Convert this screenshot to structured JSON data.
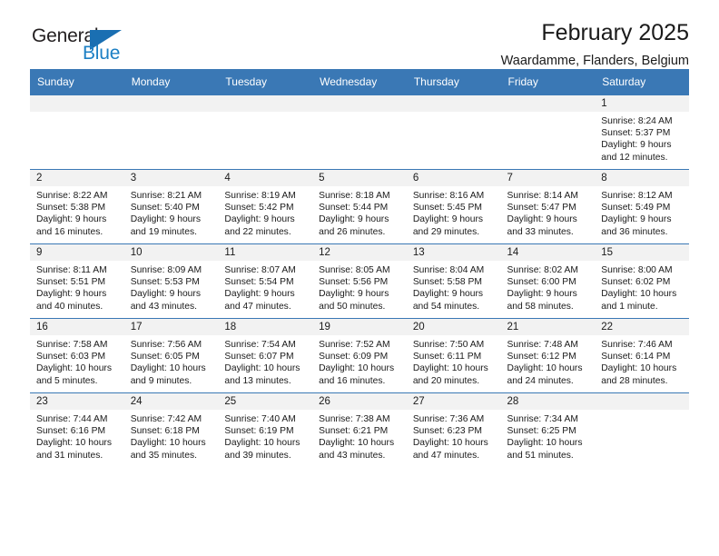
{
  "brand": {
    "name_part1": "General",
    "name_part2": "Blue",
    "accent_color": "#1c7fc4",
    "triangle_icon": "triangle-icon"
  },
  "header": {
    "title": "February 2025",
    "subtitle": "Waardamme, Flanders, Belgium",
    "header_bg_color": "#3a78b5"
  },
  "weekday_headers": [
    "Sunday",
    "Monday",
    "Tuesday",
    "Wednesday",
    "Thursday",
    "Friday",
    "Saturday"
  ],
  "weeks": [
    [
      {
        "day": "",
        "sunrise": "",
        "sunset": "",
        "daylight_line1": "",
        "daylight_line2": "",
        "empty": true
      },
      {
        "day": "",
        "sunrise": "",
        "sunset": "",
        "daylight_line1": "",
        "daylight_line2": "",
        "empty": true
      },
      {
        "day": "",
        "sunrise": "",
        "sunset": "",
        "daylight_line1": "",
        "daylight_line2": "",
        "empty": true
      },
      {
        "day": "",
        "sunrise": "",
        "sunset": "",
        "daylight_line1": "",
        "daylight_line2": "",
        "empty": true
      },
      {
        "day": "",
        "sunrise": "",
        "sunset": "",
        "daylight_line1": "",
        "daylight_line2": "",
        "empty": true
      },
      {
        "day": "",
        "sunrise": "",
        "sunset": "",
        "daylight_line1": "",
        "daylight_line2": "",
        "empty": true
      },
      {
        "day": "1",
        "sunrise": "Sunrise: 8:24 AM",
        "sunset": "Sunset: 5:37 PM",
        "daylight_line1": "Daylight: 9 hours",
        "daylight_line2": "and 12 minutes.",
        "empty": false
      }
    ],
    [
      {
        "day": "2",
        "sunrise": "Sunrise: 8:22 AM",
        "sunset": "Sunset: 5:38 PM",
        "daylight_line1": "Daylight: 9 hours",
        "daylight_line2": "and 16 minutes.",
        "empty": false
      },
      {
        "day": "3",
        "sunrise": "Sunrise: 8:21 AM",
        "sunset": "Sunset: 5:40 PM",
        "daylight_line1": "Daylight: 9 hours",
        "daylight_line2": "and 19 minutes.",
        "empty": false
      },
      {
        "day": "4",
        "sunrise": "Sunrise: 8:19 AM",
        "sunset": "Sunset: 5:42 PM",
        "daylight_line1": "Daylight: 9 hours",
        "daylight_line2": "and 22 minutes.",
        "empty": false
      },
      {
        "day": "5",
        "sunrise": "Sunrise: 8:18 AM",
        "sunset": "Sunset: 5:44 PM",
        "daylight_line1": "Daylight: 9 hours",
        "daylight_line2": "and 26 minutes.",
        "empty": false
      },
      {
        "day": "6",
        "sunrise": "Sunrise: 8:16 AM",
        "sunset": "Sunset: 5:45 PM",
        "daylight_line1": "Daylight: 9 hours",
        "daylight_line2": "and 29 minutes.",
        "empty": false
      },
      {
        "day": "7",
        "sunrise": "Sunrise: 8:14 AM",
        "sunset": "Sunset: 5:47 PM",
        "daylight_line1": "Daylight: 9 hours",
        "daylight_line2": "and 33 minutes.",
        "empty": false
      },
      {
        "day": "8",
        "sunrise": "Sunrise: 8:12 AM",
        "sunset": "Sunset: 5:49 PM",
        "daylight_line1": "Daylight: 9 hours",
        "daylight_line2": "and 36 minutes.",
        "empty": false
      }
    ],
    [
      {
        "day": "9",
        "sunrise": "Sunrise: 8:11 AM",
        "sunset": "Sunset: 5:51 PM",
        "daylight_line1": "Daylight: 9 hours",
        "daylight_line2": "and 40 minutes.",
        "empty": false
      },
      {
        "day": "10",
        "sunrise": "Sunrise: 8:09 AM",
        "sunset": "Sunset: 5:53 PM",
        "daylight_line1": "Daylight: 9 hours",
        "daylight_line2": "and 43 minutes.",
        "empty": false
      },
      {
        "day": "11",
        "sunrise": "Sunrise: 8:07 AM",
        "sunset": "Sunset: 5:54 PM",
        "daylight_line1": "Daylight: 9 hours",
        "daylight_line2": "and 47 minutes.",
        "empty": false
      },
      {
        "day": "12",
        "sunrise": "Sunrise: 8:05 AM",
        "sunset": "Sunset: 5:56 PM",
        "daylight_line1": "Daylight: 9 hours",
        "daylight_line2": "and 50 minutes.",
        "empty": false
      },
      {
        "day": "13",
        "sunrise": "Sunrise: 8:04 AM",
        "sunset": "Sunset: 5:58 PM",
        "daylight_line1": "Daylight: 9 hours",
        "daylight_line2": "and 54 minutes.",
        "empty": false
      },
      {
        "day": "14",
        "sunrise": "Sunrise: 8:02 AM",
        "sunset": "Sunset: 6:00 PM",
        "daylight_line1": "Daylight: 9 hours",
        "daylight_line2": "and 58 minutes.",
        "empty": false
      },
      {
        "day": "15",
        "sunrise": "Sunrise: 8:00 AM",
        "sunset": "Sunset: 6:02 PM",
        "daylight_line1": "Daylight: 10 hours",
        "daylight_line2": "and 1 minute.",
        "empty": false
      }
    ],
    [
      {
        "day": "16",
        "sunrise": "Sunrise: 7:58 AM",
        "sunset": "Sunset: 6:03 PM",
        "daylight_line1": "Daylight: 10 hours",
        "daylight_line2": "and 5 minutes.",
        "empty": false
      },
      {
        "day": "17",
        "sunrise": "Sunrise: 7:56 AM",
        "sunset": "Sunset: 6:05 PM",
        "daylight_line1": "Daylight: 10 hours",
        "daylight_line2": "and 9 minutes.",
        "empty": false
      },
      {
        "day": "18",
        "sunrise": "Sunrise: 7:54 AM",
        "sunset": "Sunset: 6:07 PM",
        "daylight_line1": "Daylight: 10 hours",
        "daylight_line2": "and 13 minutes.",
        "empty": false
      },
      {
        "day": "19",
        "sunrise": "Sunrise: 7:52 AM",
        "sunset": "Sunset: 6:09 PM",
        "daylight_line1": "Daylight: 10 hours",
        "daylight_line2": "and 16 minutes.",
        "empty": false
      },
      {
        "day": "20",
        "sunrise": "Sunrise: 7:50 AM",
        "sunset": "Sunset: 6:11 PM",
        "daylight_line1": "Daylight: 10 hours",
        "daylight_line2": "and 20 minutes.",
        "empty": false
      },
      {
        "day": "21",
        "sunrise": "Sunrise: 7:48 AM",
        "sunset": "Sunset: 6:12 PM",
        "daylight_line1": "Daylight: 10 hours",
        "daylight_line2": "and 24 minutes.",
        "empty": false
      },
      {
        "day": "22",
        "sunrise": "Sunrise: 7:46 AM",
        "sunset": "Sunset: 6:14 PM",
        "daylight_line1": "Daylight: 10 hours",
        "daylight_line2": "and 28 minutes.",
        "empty": false
      }
    ],
    [
      {
        "day": "23",
        "sunrise": "Sunrise: 7:44 AM",
        "sunset": "Sunset: 6:16 PM",
        "daylight_line1": "Daylight: 10 hours",
        "daylight_line2": "and 31 minutes.",
        "empty": false
      },
      {
        "day": "24",
        "sunrise": "Sunrise: 7:42 AM",
        "sunset": "Sunset: 6:18 PM",
        "daylight_line1": "Daylight: 10 hours",
        "daylight_line2": "and 35 minutes.",
        "empty": false
      },
      {
        "day": "25",
        "sunrise": "Sunrise: 7:40 AM",
        "sunset": "Sunset: 6:19 PM",
        "daylight_line1": "Daylight: 10 hours",
        "daylight_line2": "and 39 minutes.",
        "empty": false
      },
      {
        "day": "26",
        "sunrise": "Sunrise: 7:38 AM",
        "sunset": "Sunset: 6:21 PM",
        "daylight_line1": "Daylight: 10 hours",
        "daylight_line2": "and 43 minutes.",
        "empty": false
      },
      {
        "day": "27",
        "sunrise": "Sunrise: 7:36 AM",
        "sunset": "Sunset: 6:23 PM",
        "daylight_line1": "Daylight: 10 hours",
        "daylight_line2": "and 47 minutes.",
        "empty": false
      },
      {
        "day": "28",
        "sunrise": "Sunrise: 7:34 AM",
        "sunset": "Sunset: 6:25 PM",
        "daylight_line1": "Daylight: 10 hours",
        "daylight_line2": "and 51 minutes.",
        "empty": false
      },
      {
        "day": "",
        "sunrise": "",
        "sunset": "",
        "daylight_line1": "",
        "daylight_line2": "",
        "empty": true
      }
    ]
  ]
}
